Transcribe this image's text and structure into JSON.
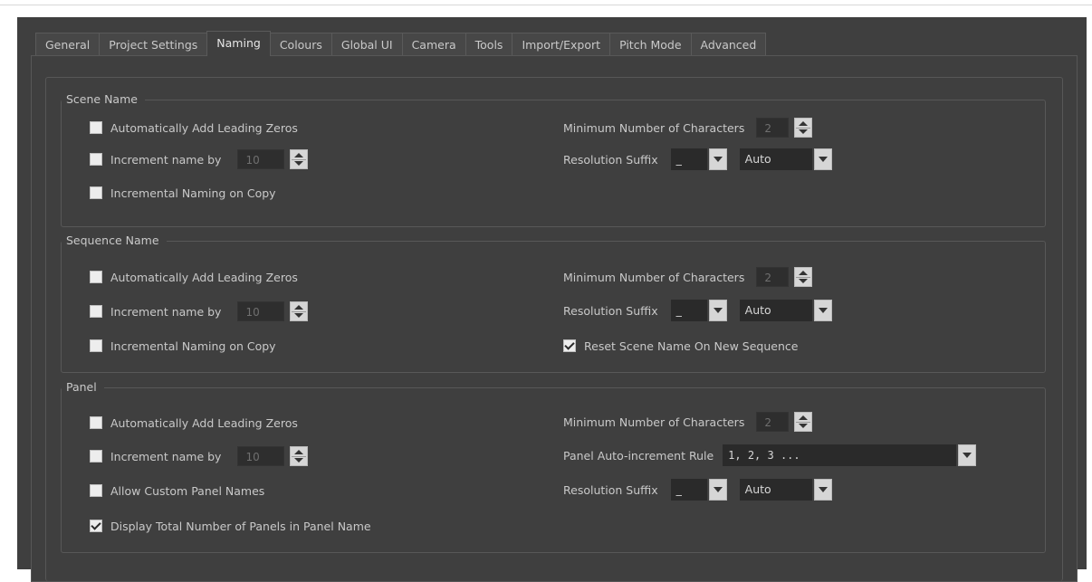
{
  "tabs": [
    {
      "label": "General"
    },
    {
      "label": "Project Settings"
    },
    {
      "label": "Naming",
      "active": true
    },
    {
      "label": "Colours"
    },
    {
      "label": "Global UI"
    },
    {
      "label": "Camera"
    },
    {
      "label": "Tools"
    },
    {
      "label": "Import/Export"
    },
    {
      "label": "Pitch Mode"
    },
    {
      "label": "Advanced"
    }
  ],
  "scene": {
    "title": "Scene Name",
    "leading_zeros": {
      "label": "Automatically Add Leading Zeros",
      "checked": false
    },
    "increment": {
      "label": "Increment name by",
      "checked": false,
      "value": "10"
    },
    "incremental_copy": {
      "label": "Incremental Naming on Copy",
      "checked": false
    },
    "min_chars": {
      "label": "Minimum Number of Characters",
      "value": "2"
    },
    "resolution": {
      "label": "Resolution Suffix",
      "separator": "_",
      "mode": "Auto"
    }
  },
  "sequence": {
    "title": "Sequence Name",
    "leading_zeros": {
      "label": "Automatically Add Leading Zeros",
      "checked": false
    },
    "increment": {
      "label": "Increment name by",
      "checked": false,
      "value": "10"
    },
    "incremental_copy": {
      "label": "Incremental Naming on Copy",
      "checked": false
    },
    "min_chars": {
      "label": "Minimum Number of Characters",
      "value": "2"
    },
    "resolution": {
      "label": "Resolution Suffix",
      "separator": "_",
      "mode": "Auto"
    },
    "reset_scene": {
      "label": "Reset Scene Name On New Sequence",
      "checked": true
    }
  },
  "panel": {
    "title": "Panel",
    "leading_zeros": {
      "label": "Automatically Add Leading Zeros",
      "checked": false
    },
    "increment": {
      "label": "Increment name by",
      "checked": false,
      "value": "10"
    },
    "custom_names": {
      "label": "Allow Custom Panel Names",
      "checked": false
    },
    "display_total": {
      "label": "Display Total Number of Panels in Panel Name",
      "checked": true
    },
    "min_chars": {
      "label": "Minimum Number of Characters",
      "value": "2"
    },
    "auto_increment": {
      "label": "Panel Auto-increment Rule",
      "value": "1, 2, 3 ..."
    },
    "resolution": {
      "label": "Resolution Suffix",
      "separator": "_",
      "mode": "Auto"
    }
  }
}
